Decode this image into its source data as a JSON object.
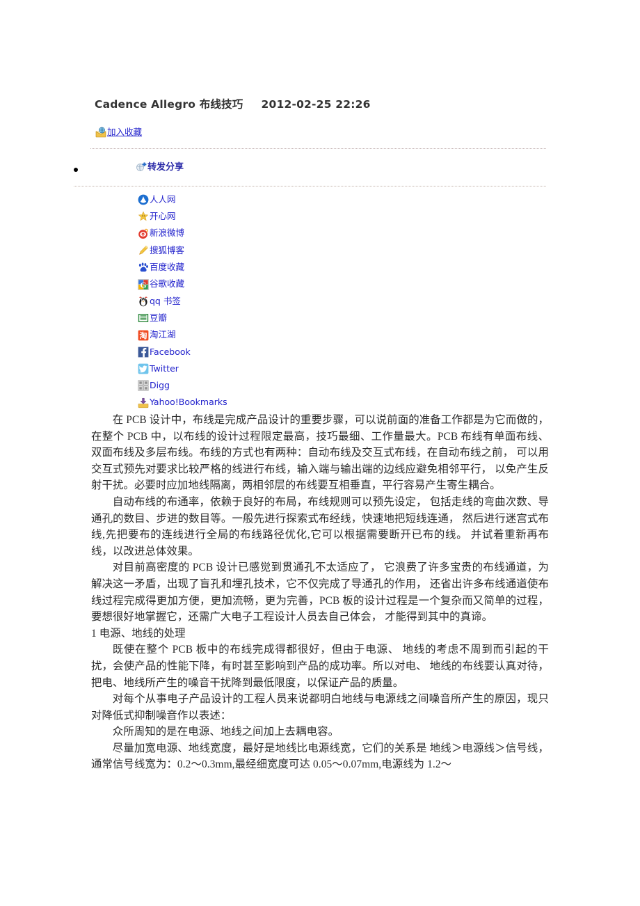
{
  "post": {
    "title": "Cadence Allegro 布线技巧",
    "date": "2012-02-25 22:26"
  },
  "actions": {
    "favorite_label": "加入收藏",
    "favorite_icon": "folder-mail-icon",
    "share_label": "转发分享",
    "share_icon": "share-plus-icon"
  },
  "social": {
    "items": [
      {
        "label": "人人网",
        "icon": "renren-icon"
      },
      {
        "label": "开心网",
        "icon": "kaixin-star-icon"
      },
      {
        "label": "新浪微博",
        "icon": "sina-weibo-eye-icon"
      },
      {
        "label": "搜狐博客",
        "icon": "sohu-blog-icon"
      },
      {
        "label": "百度收藏",
        "icon": "baidu-paw-icon"
      },
      {
        "label": "谷歌收藏",
        "icon": "google-g-icon"
      },
      {
        "label": "qq 书签",
        "icon": "qq-penguin-icon"
      },
      {
        "label": "豆瓣",
        "icon": "douban-icon"
      },
      {
        "label": "淘江湖",
        "icon": "taobao-icon"
      },
      {
        "label": "Facebook",
        "icon": "facebook-icon"
      },
      {
        "label": "Twitter",
        "icon": "twitter-bird-icon"
      },
      {
        "label": "Digg",
        "icon": "digg-icon"
      },
      {
        "label": "Yahoo!Bookmarks",
        "icon": "yahoo-bookmarks-icon"
      }
    ]
  },
  "article": {
    "paragraphs": [
      "在 PCB 设计中，布线是完成产品设计的重要步骤，可以说前面的准备工作都是为它而做的， 在整个 PCB 中，以布线的设计过程限定最高，技巧最细、工作量最大。PCB 布线有单面布线、 双面布线及多层布线。布线的方式也有两种：自动布线及交互式布线，在自动布线之前， 可以用交互式预先对要求比较严格的线进行布线，输入端与输出端的边线应避免相邻平行， 以免产生反射干扰。必要时应加地线隔离，两相邻层的布线要互相垂直，平行容易产生寄生耦合。",
      "自动布线的布通率，依赖于良好的布局，布线规则可以预先设定， 包括走线的弯曲次数、导通孔的数目、步进的数目等。一般先进行探索式布经线，快速地把短线连通， 然后进行迷宫式布线,先把要布的连线进行全局的布线路径优化,它可以根据需要断开已布的线。 并试着重新再布线，以改进总体效果。",
      "对目前高密度的 PCB 设计已感觉到贯通孔不太适应了， 它浪费了许多宝贵的布线通道，为解决这一矛盾，出现了盲孔和埋孔技术，它不仅完成了导通孔的作用， 还省出许多布线通道使布线过程完成得更加方便，更加流畅，更为完善，PCB 板的设计过程是一个复杂而又简单的过程，要想很好地掌握它，还需广大电子工程设计人员去自己体会， 才能得到其中的真谛。",
      "1 电源、地线的处理",
      "既使在整个 PCB 板中的布线完成得都很好，但由于电源、 地线的考虑不周到而引起的干扰，会使产品的性能下降，有时甚至影响到产品的成功率。所以对电、 地线的布线要认真对待，把电、地线所产生的噪音干扰降到最低限度，以保证产品的质量。",
      "对每个从事电子产品设计的工程人员来说都明白地线与电源线之间噪音所产生的原因，现只对降低式抑制噪音作以表述：",
      "众所周知的是在电源、地线之间加上去耦电容。",
      "尽量加宽电源、地线宽度，最好是地线比电源线宽，它们的关系是 地线＞电源线＞信号线，通常信号线宽为：0.2～0.3mm,最经细宽度可达 0.05～0.07mm,电源线为 1.2～"
    ]
  },
  "colors": {
    "link": "#2222cc",
    "share_link": "#2a2aa8",
    "title": "#333333",
    "body_text": "#2b2b2b",
    "divider": "#c8b8b8",
    "page_background": "#ffffff"
  }
}
